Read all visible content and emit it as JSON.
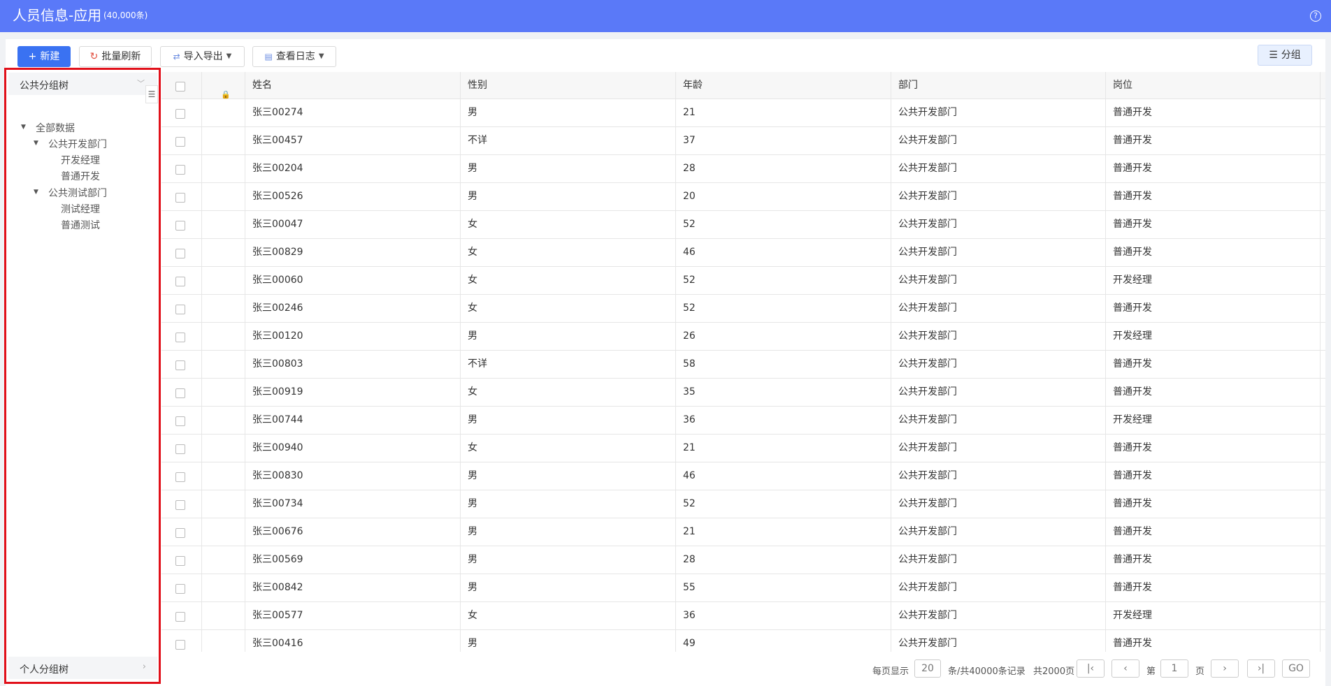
{
  "header": {
    "title": "人员信息-应用",
    "count": "(40,000条)",
    "help_icon": "?"
  },
  "toolbar": {
    "new_label": "新建",
    "refresh_label": "批量刷新",
    "import_export_label": "导入导出",
    "log_label": "查看日志",
    "group_label": "分组"
  },
  "sidebar": {
    "public_tree_title": "公共分组树",
    "personal_tree_title": "个人分组树",
    "tree": {
      "all": "全部数据",
      "dev_dept": "公共开发部门",
      "dev_manager": "开发经理",
      "dev_normal": "普通开发",
      "test_dept": "公共测试部门",
      "test_manager": "测试经理",
      "test_normal": "普通测试"
    }
  },
  "table": {
    "columns": [
      "姓名",
      "性别",
      "年龄",
      "部门",
      "岗位"
    ],
    "rows": [
      [
        "张三00274",
        "男",
        "21",
        "公共开发部门",
        "普通开发"
      ],
      [
        "张三00457",
        "不详",
        "37",
        "公共开发部门",
        "普通开发"
      ],
      [
        "张三00204",
        "男",
        "28",
        "公共开发部门",
        "普通开发"
      ],
      [
        "张三00526",
        "男",
        "20",
        "公共开发部门",
        "普通开发"
      ],
      [
        "张三00047",
        "女",
        "52",
        "公共开发部门",
        "普通开发"
      ],
      [
        "张三00829",
        "女",
        "46",
        "公共开发部门",
        "普通开发"
      ],
      [
        "张三00060",
        "女",
        "52",
        "公共开发部门",
        "开发经理"
      ],
      [
        "张三00246",
        "女",
        "52",
        "公共开发部门",
        "普通开发"
      ],
      [
        "张三00120",
        "男",
        "26",
        "公共开发部门",
        "开发经理"
      ],
      [
        "张三00803",
        "不详",
        "58",
        "公共开发部门",
        "普通开发"
      ],
      [
        "张三00919",
        "女",
        "35",
        "公共开发部门",
        "普通开发"
      ],
      [
        "张三00744",
        "男",
        "36",
        "公共开发部门",
        "开发经理"
      ],
      [
        "张三00940",
        "女",
        "21",
        "公共开发部门",
        "普通开发"
      ],
      [
        "张三00830",
        "男",
        "46",
        "公共开发部门",
        "普通开发"
      ],
      [
        "张三00734",
        "男",
        "52",
        "公共开发部门",
        "普通开发"
      ],
      [
        "张三00676",
        "男",
        "21",
        "公共开发部门",
        "普通开发"
      ],
      [
        "张三00569",
        "男",
        "28",
        "公共开发部门",
        "普通开发"
      ],
      [
        "张三00842",
        "男",
        "55",
        "公共开发部门",
        "普通开发"
      ],
      [
        "张三00577",
        "女",
        "36",
        "公共开发部门",
        "开发经理"
      ],
      [
        "张三00416",
        "男",
        "49",
        "公共开发部门",
        "普通开发"
      ]
    ]
  },
  "pager": {
    "per_page_label": "每页显示",
    "per_page_value": "20",
    "records_label": "条/共40000条记录",
    "total_pages": "共2000页",
    "page_prefix": "第",
    "page_value": "1",
    "page_suffix": "页",
    "go_label": "GO"
  }
}
